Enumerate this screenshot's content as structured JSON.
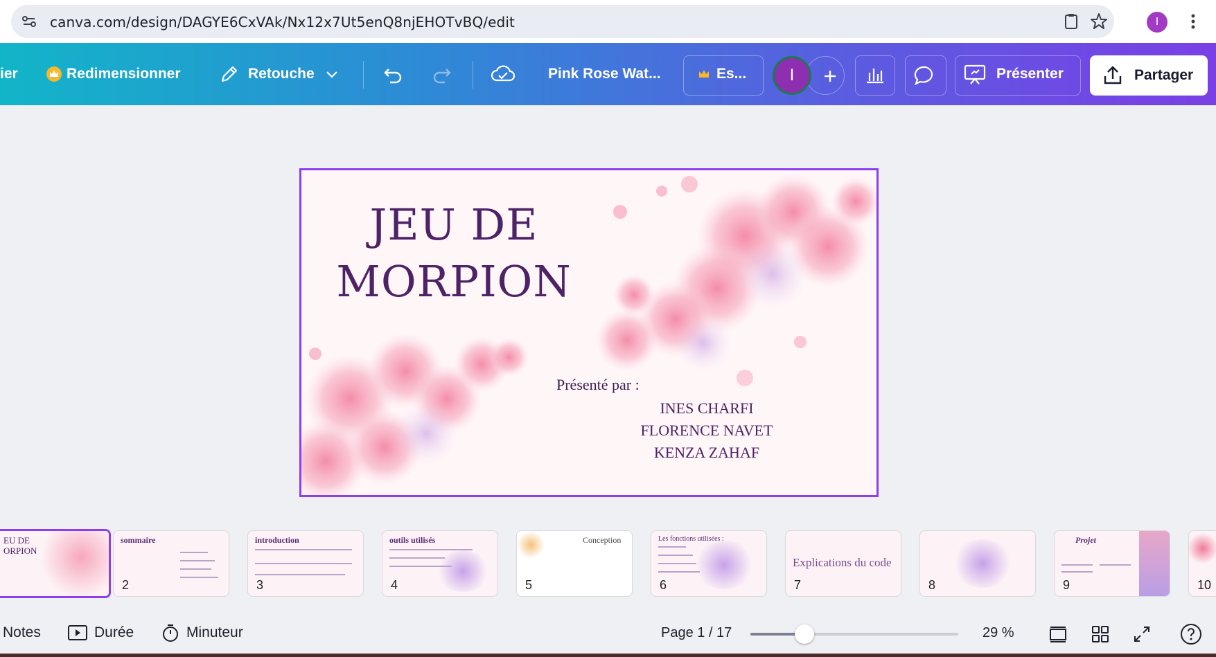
{
  "browser": {
    "url": "canva.com/design/DAGYE6CxVAk/Nx12x7Ut5enQ8njEHOTvBQ/edit",
    "profile_initial": "I"
  },
  "toolbar": {
    "file_partial": "ier",
    "resize_label": "Redimensionner",
    "retouch_label": "Retouche",
    "design_name": "Pink Rose Wat...",
    "premium_label": "Es...",
    "avatar_initial": "I",
    "present_label": "Présenter",
    "share_label": "Partager"
  },
  "slide": {
    "title_line1": "JEU DE",
    "title_line2": "MORPION",
    "presented_by": "Présenté par :",
    "names": [
      "INES CHARFI",
      "FLORENCE NAVET",
      "KENZA ZAHAF"
    ]
  },
  "thumbnails": [
    {
      "num": "",
      "title": "EU DE\nORPION",
      "active": true
    },
    {
      "num": "2",
      "title": "sommaire"
    },
    {
      "num": "3",
      "title": "introduction"
    },
    {
      "num": "4",
      "title": "outils utilisés"
    },
    {
      "num": "5",
      "title": "Conception"
    },
    {
      "num": "6",
      "title": "Les fonctions utilisées :"
    },
    {
      "num": "7",
      "title": "Explications du code"
    },
    {
      "num": "8",
      "title": ""
    },
    {
      "num": "9",
      "title": "Projet"
    },
    {
      "num": "10",
      "title": ""
    }
  ],
  "bottom": {
    "notes_label": "Notes",
    "duration_label": "Durée",
    "timer_label": "Minuteur",
    "page_label": "Page 1 / 17",
    "zoom_label": "29 %",
    "zoom_fraction": 0.26
  },
  "colors": {
    "accent": "#8b3ff0",
    "title_purple": "#4e2266"
  }
}
